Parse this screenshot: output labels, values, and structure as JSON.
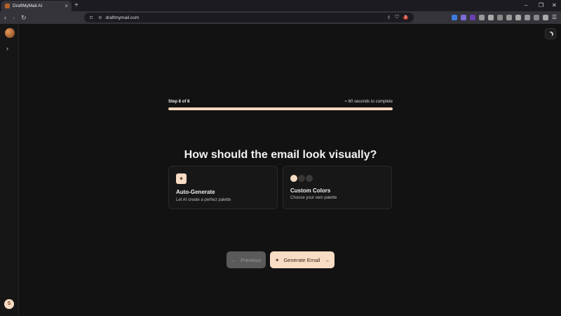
{
  "browser": {
    "tab_title": "DraftMyMail AI",
    "url": "draftmymail.com",
    "notification_count": "3"
  },
  "progress": {
    "step_label": "Step 8 of 8",
    "time_estimate": "≈ 60 seconds to complete",
    "fraction": 1.0
  },
  "question": "How should the email look visually?",
  "options": [
    {
      "title": "Auto-Generate",
      "description": "Let AI create a perfect palette",
      "icon": "sparkles-icon"
    },
    {
      "title": "Custom Colors",
      "description": "Choose your own palette",
      "swatches": [
        "#f6dcc3",
        "#3a3632",
        "#3a3a3a"
      ]
    }
  ],
  "buttons": {
    "previous": "Previous",
    "generate": "Generate Email"
  },
  "user": {
    "initial": "S"
  },
  "colors": {
    "accent": "#f6dcc3",
    "background": "#121212"
  }
}
